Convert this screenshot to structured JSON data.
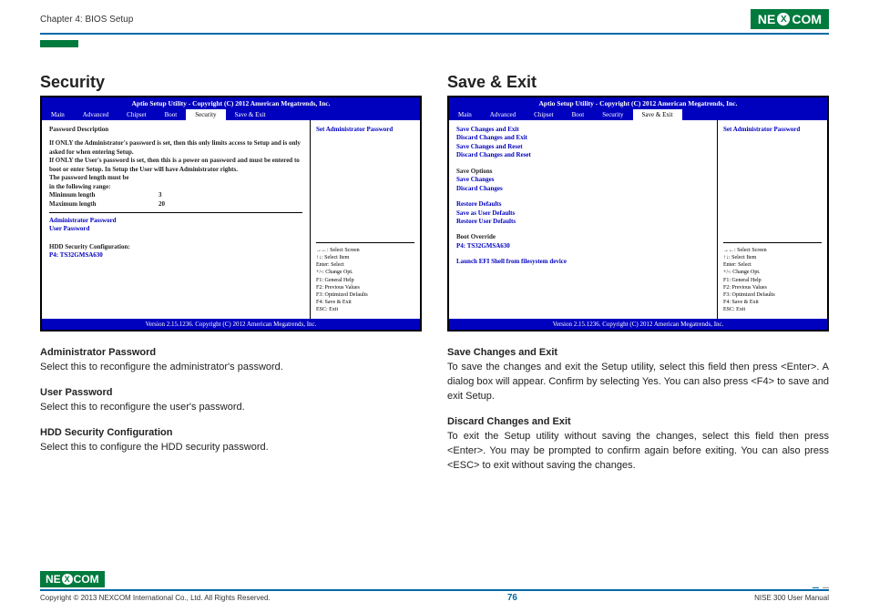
{
  "header": {
    "chapter": "Chapter 4: BIOS Setup",
    "logo_left": "NE",
    "logo_x": "X",
    "logo_right": "COM"
  },
  "left": {
    "heading": "Security",
    "bios": {
      "title": "Aptio Setup Utility - Copyright (C) 2012 American Megatrends, Inc.",
      "tabs": [
        "Main",
        "Advanced",
        "Chipset",
        "Boot",
        "Security",
        "Save & Exit"
      ],
      "active_tab_index": 4,
      "pwd_desc_head": "Password Description",
      "pwd_desc_body": "If ONLY the Administrator's password is set, then this only limits access to Setup and is only asked for when entering Setup.\nIf ONLY the User's password is set, then this is a power on password and must be entered to boot or enter Setup. In Setup the User will have Administrator rights.",
      "len_head": "The password length must be in the following range:",
      "min_label": "Minimum length",
      "min_val": "3",
      "max_label": "Maximum length",
      "max_val": "20",
      "admin_pw": "Administrator Password",
      "user_pw": "User Password",
      "hdd_head": "HDD Security Configuration:",
      "hdd_dev": "P4: TS32GMSA630",
      "help": "Set Administrator Password",
      "keys": "→←: Select Screen\n↑↓: Select Item\nEnter: Select\n+/-: Change Opt.\nF1: General Help\nF2: Previous Values\nF3: Optimized Defaults\nF4: Save & Exit\nESC: Exit",
      "footer": "Version 2.15.1236. Copyright (C) 2012 American Megatrends, Inc."
    },
    "desc": [
      {
        "title": "Administrator Password",
        "body": "Select this to reconfigure the administrator's password."
      },
      {
        "title": "User Password",
        "body": "Select this to reconfigure the user's password."
      },
      {
        "title": "HDD Security Configuration",
        "body": "Select this to configure the HDD security password."
      }
    ]
  },
  "right": {
    "heading": "Save & Exit",
    "bios": {
      "title": "Aptio Setup Utility - Copyright (C) 2012 American Megatrends, Inc.",
      "tabs": [
        "Main",
        "Advanced",
        "Chipset",
        "Boot",
        "Security",
        "Save & Exit"
      ],
      "active_tab_index": 5,
      "group1": [
        "Save Changes and Exit",
        "Discard Changes and Exit",
        "Save Changes and Reset",
        "Discard Changes and Reset"
      ],
      "save_opts_head": "Save Options",
      "group2": [
        "Save Changes",
        "Discard Changes"
      ],
      "group3": [
        "Restore Defaults",
        "Save as User Defaults",
        "Restore User Defaults"
      ],
      "boot_override": "Boot Override",
      "boot_dev": "P4: TS32GMSA630",
      "launch": "Launch EFI Shell from filesystem device",
      "help": "Set Administrator Password",
      "keys": "→←: Select Screen\n↑↓: Select Item\nEnter: Select\n+/-: Change Opt.\nF1: General Help\nF2: Previous Values\nF3: Optimized Defaults\nF4: Save & Exit\nESC: Exit",
      "footer": "Version 2.15.1236. Copyright (C) 2012 American Megatrends, Inc."
    },
    "desc": [
      {
        "title": "Save Changes and Exit",
        "body": "To save the changes and exit the Setup utility, select this field then press <Enter>. A dialog box will appear. Confirm by selecting Yes. You can also press <F4> to save and exit Setup."
      },
      {
        "title": "Discard Changes and Exit",
        "body": "To exit the Setup utility without saving the changes, select this field then press <Enter>. You may be prompted to confirm again before exiting. You can also press <ESC> to exit without saving the changes."
      }
    ]
  },
  "footer": {
    "copyright": "Copyright © 2013 NEXCOM International Co., Ltd. All Rights Reserved.",
    "page": "76",
    "manual": "NISE 300 User Manual"
  }
}
